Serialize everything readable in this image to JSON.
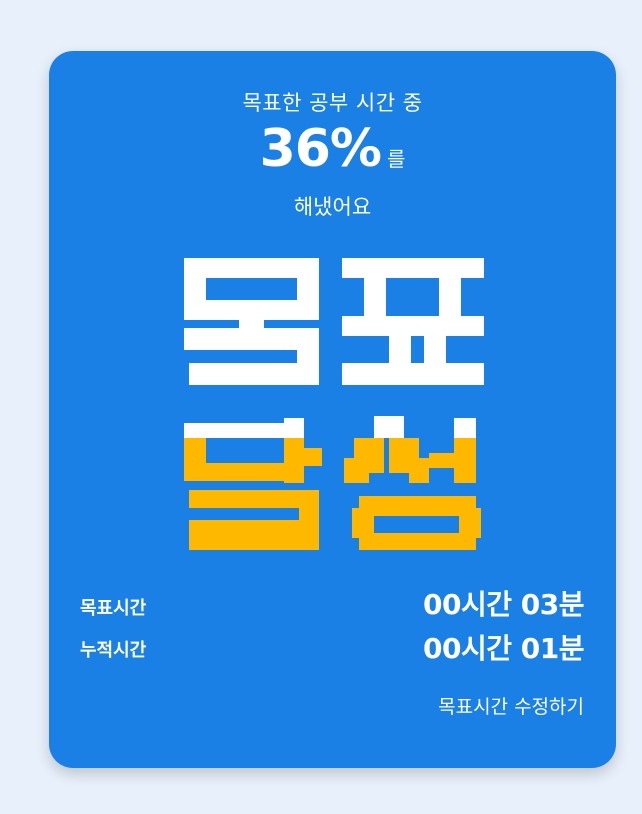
{
  "progress": {
    "subtitle": "목표한 공부 시간 중",
    "percent": "36%",
    "percent_suffix": "를",
    "done_text": "해냈어요"
  },
  "badge": {
    "line1": "목표",
    "line2": "달성",
    "fill_percent": 36,
    "colors": {
      "white": "#ffffff",
      "yellow": "#ffb800",
      "card": "#1a80e6"
    }
  },
  "stats": {
    "goal_label": "목표시간",
    "goal_value": "00시간 03분",
    "accum_label": "누적시간",
    "accum_value": "00시간 01분"
  },
  "edit_label": "목표시간 수정하기"
}
